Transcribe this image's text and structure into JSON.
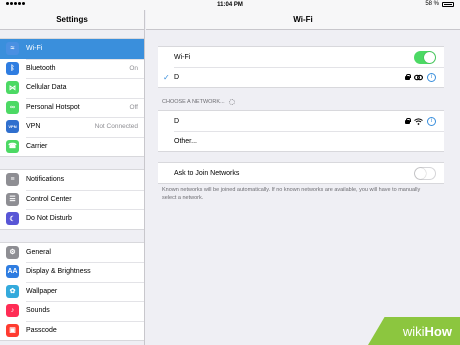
{
  "status_bar": {
    "time": "11:04 PM",
    "battery": "58 %"
  },
  "sidebar": {
    "title": "Settings",
    "groups": [
      [
        {
          "label": "Wi-Fi",
          "value": "",
          "icon": "wifi-icon",
          "color": "#4a90e2",
          "selected": true
        },
        {
          "label": "Bluetooth",
          "value": "On",
          "icon": "bluetooth-icon",
          "color": "#2f7de1"
        },
        {
          "label": "Cellular Data",
          "value": "",
          "icon": "cellular-icon",
          "color": "#4cd964"
        },
        {
          "label": "Personal Hotspot",
          "value": "Off",
          "icon": "hotspot-icon",
          "color": "#4cd964"
        },
        {
          "label": "VPN",
          "value": "Not Connected",
          "icon": "vpn-icon",
          "color": "#2f6fce"
        },
        {
          "label": "Carrier",
          "value": "",
          "icon": "phone-icon",
          "color": "#4cd964"
        }
      ],
      [
        {
          "label": "Notifications",
          "value": "",
          "icon": "notifications-icon",
          "color": "#8e8e93"
        },
        {
          "label": "Control Center",
          "value": "",
          "icon": "control-center-icon",
          "color": "#8e8e93"
        },
        {
          "label": "Do Not Disturb",
          "value": "",
          "icon": "moon-icon",
          "color": "#5856d6"
        }
      ],
      [
        {
          "label": "General",
          "value": "",
          "icon": "gear-icon",
          "color": "#8e8e93"
        },
        {
          "label": "Display & Brightness",
          "value": "",
          "icon": "display-icon",
          "color": "#2f7de1"
        },
        {
          "label": "Wallpaper",
          "value": "",
          "icon": "wallpaper-icon",
          "color": "#34aadc"
        },
        {
          "label": "Sounds",
          "value": "",
          "icon": "sounds-icon",
          "color": "#ff2d55"
        },
        {
          "label": "Passcode",
          "value": "",
          "icon": "passcode-icon",
          "color": "#ff3b30"
        }
      ]
    ],
    "icon_glyphs": {
      "wifi-icon": "≈",
      "bluetooth-icon": "ᛒ",
      "cellular-icon": "⋈",
      "hotspot-icon": "∞",
      "vpn-icon": "VPN",
      "phone-icon": "☎",
      "notifications-icon": "≡",
      "control-center-icon": "☰",
      "moon-icon": "☾",
      "gear-icon": "⚙",
      "display-icon": "AA",
      "wallpaper-icon": "✿",
      "sounds-icon": "♪",
      "passcode-icon": "▣"
    }
  },
  "main": {
    "title": "Wi-Fi",
    "wifi_label": "Wi-Fi",
    "wifi_enabled": true,
    "connected_network": "D",
    "choose_network_title": "CHOOSE A NETWORK...",
    "networks": [
      {
        "name": "D"
      }
    ],
    "other_label": "Other...",
    "ask_to_join_label": "Ask to Join Networks",
    "ask_to_join_enabled": false,
    "ask_to_join_footnote": "Known networks will be joined automatically. If no known networks are available, you will have to manually select a network."
  },
  "watermark": {
    "wiki": "wiki",
    "how": "How"
  },
  "colors": {
    "accent": "#3a8fdc",
    "toggle_on": "#4cd964",
    "watermark": "#8cc63f"
  }
}
